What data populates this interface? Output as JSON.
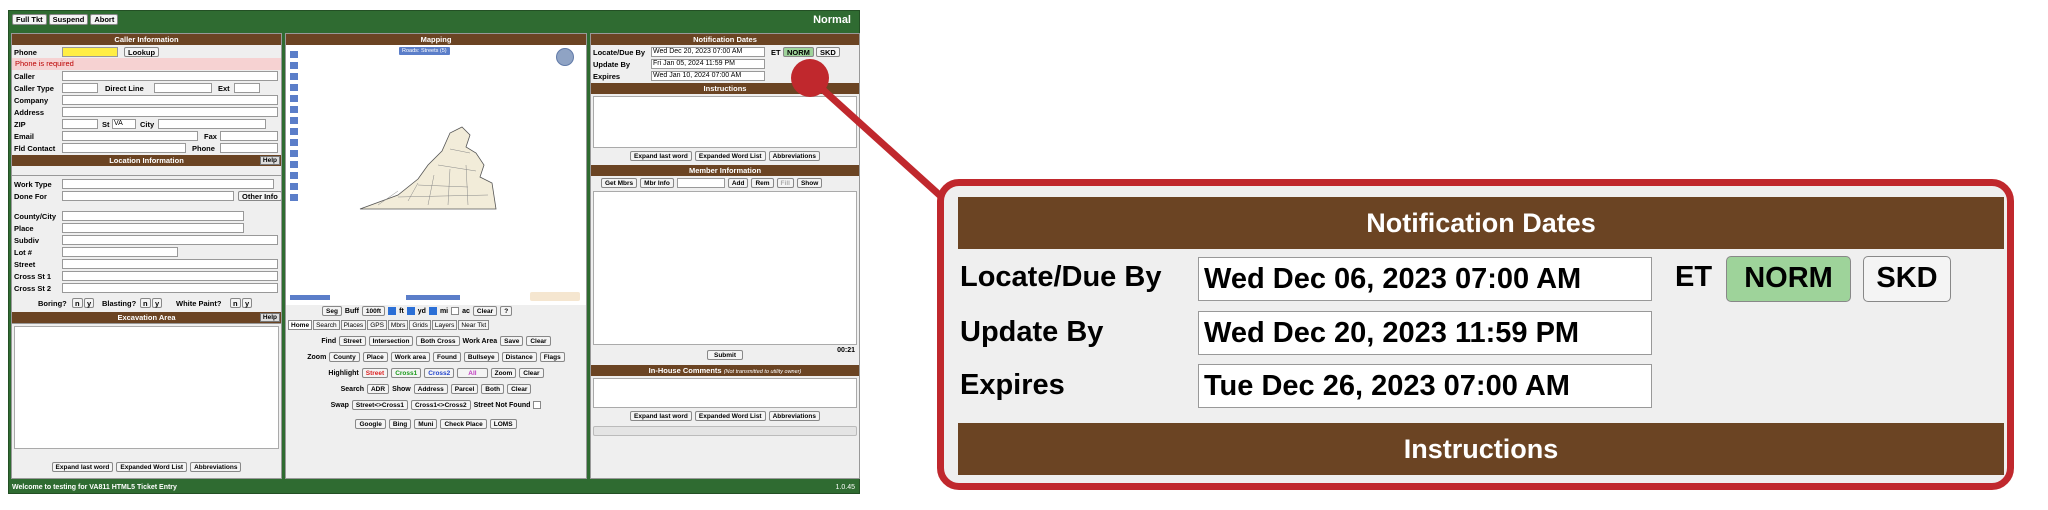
{
  "topbar": {
    "buttons": [
      "Full Tkt",
      "Suspend",
      "Abort"
    ],
    "status": "Normal"
  },
  "caller": {
    "title": "Caller Information",
    "phone_label": "Phone",
    "lookup": "Lookup",
    "phone_error": "Phone is required",
    "caller_label": "Caller",
    "caller_type_label": "Caller Type",
    "direct_line_label": "Direct Line",
    "ext_label": "Ext",
    "company_label": "Company",
    "address_label": "Address",
    "zip_label": "ZIP",
    "st_label": "St",
    "state_value": "VA",
    "city_label": "City",
    "email_label": "Email",
    "fax_label": "Fax",
    "fld_contact_label": "Fld Contact",
    "phone2_label": "Phone"
  },
  "location": {
    "title": "Location Information",
    "help": "Help",
    "work_type": "Work Type",
    "done_for": "Done For",
    "other_info": "Other Info",
    "county_city": "County/City",
    "place": "Place",
    "subdiv": "Subdiv",
    "lot": "Lot #",
    "street": "Street",
    "cross1": "Cross St 1",
    "cross2": "Cross St 2",
    "boring": "Boring?",
    "blasting": "Blasting?",
    "white_paint": "White Paint?",
    "n": "n",
    "y": "y"
  },
  "excavation": {
    "title": "Excavation Area",
    "help": "Help",
    "buttons": [
      "Expand last word",
      "Expanded Word List",
      "Abbreviations"
    ]
  },
  "mapping": {
    "title": "Mapping",
    "basemap": "Roads: Streets (5)",
    "seg": "Seg",
    "buff": "Buff",
    "buff_val": "100ft",
    "ft": "ft",
    "yd": "yd",
    "mi": "mi",
    "ac": "ac",
    "clear": "Clear",
    "q": "?",
    "tabs": [
      "Home",
      "Search",
      "Places",
      "GPS",
      "Mbrs",
      "Grids",
      "Layers",
      "Near Tkt"
    ],
    "find_label": "Find",
    "find_buttons": [
      "Street",
      "Intersection",
      "Both Cross"
    ],
    "work_area_label": "Work Area",
    "work_area_buttons": [
      "Save",
      "Clear"
    ],
    "zoom_label": "Zoom",
    "zoom_buttons": [
      "County",
      "Place",
      "Work area",
      "Found",
      "Bullseye",
      "Distance",
      "Flags"
    ],
    "highlight_label": "Highlight",
    "highlight_buttons": [
      "Street",
      "Cross1",
      "Cross2",
      "All"
    ],
    "highlight_zoom": "Zoom",
    "highlight_clear": "Clear",
    "search_label": "Search",
    "search_buttons": [
      "ADR",
      "Show",
      "Address",
      "Parcel",
      "Both",
      "Clear"
    ],
    "swap_label": "Swap",
    "swap_buttons": [
      "Street<>Cross1",
      "Cross1<>Cross2"
    ],
    "street_not_found": "Street Not Found",
    "ext_buttons": [
      "Google",
      "Bing",
      "Muni",
      "Check Place",
      "LOMS"
    ]
  },
  "notification": {
    "title": "Notification Dates",
    "locate_label": "Locate/Due By",
    "locate_value": "Wed Dec 20, 2023 07:00 AM",
    "et": "ET",
    "norm": "NORM",
    "skd": "SKD",
    "update_label": "Update By",
    "update_value": "Fri Jan 05, 2024 11:59 PM",
    "expires_label": "Expires",
    "expires_value": "Wed Jan 10, 2024 07:00 AM"
  },
  "instructions": {
    "title": "Instructions",
    "buttons": [
      "Expand last word",
      "Expanded Word List",
      "Abbreviations"
    ]
  },
  "member": {
    "title": "Member Information",
    "buttons": [
      "Get Mbrs",
      "Mbr Info"
    ],
    "add": "Add",
    "rem": "Rem",
    "fill": "Fill",
    "show": "Show",
    "timer": "00:21",
    "submit": "Submit"
  },
  "inhouse": {
    "title": "In-House Comments",
    "note": "(Not transmitted to utility owner)",
    "buttons": [
      "Expand last word",
      "Expanded Word List",
      "Abbreviations"
    ]
  },
  "footer": {
    "welcome": "Welcome to testing for VA811 HTML5 Ticket Entry",
    "version": "1.0.45"
  },
  "zoom": {
    "title": "Notification Dates",
    "locate_label": "Locate/Due By",
    "locate_value": "Wed Dec 06, 2023 07:00 AM",
    "et": "ET",
    "norm": "NORM",
    "skd": "SKD",
    "update_label": "Update By",
    "update_value": "Wed Dec 20, 2023 11:59 PM",
    "expires_label": "Expires",
    "expires_value": "Tue Dec 26, 2023 07:00 AM",
    "instructions": "Instructions"
  },
  "colors": {
    "app_green": "#2f6b31",
    "header_brown": "#6b4423",
    "norm_green": "#9ed39a",
    "callout_red": "#c0282d",
    "phone_yellow": "#ffee44"
  }
}
